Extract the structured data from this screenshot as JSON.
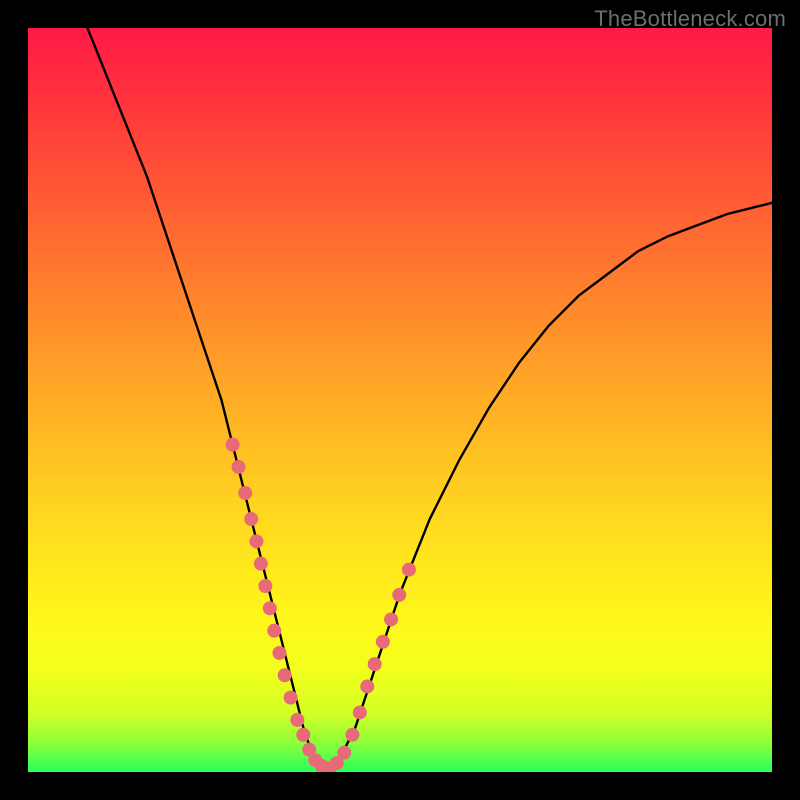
{
  "watermark": "TheBottleneck.com",
  "chart_data": {
    "type": "line",
    "title": "",
    "xlabel": "",
    "ylabel": "",
    "xlim": [
      0,
      100
    ],
    "ylim": [
      0,
      100
    ],
    "series": [
      {
        "name": "bottleneck-curve",
        "x": [
          8,
          12,
          16,
          20,
          22,
          24,
          26,
          28,
          30,
          32,
          33,
          34,
          35,
          36,
          37,
          38,
          39,
          40,
          41,
          42,
          44,
          46,
          48,
          50,
          54,
          58,
          62,
          66,
          70,
          74,
          78,
          82,
          86,
          90,
          94,
          98,
          100
        ],
        "y": [
          100,
          90,
          80,
          68,
          62,
          56,
          50,
          42,
          34,
          26,
          22,
          18,
          14,
          10,
          6,
          3,
          1,
          0,
          0.5,
          2,
          6,
          12,
          18,
          24,
          34,
          42,
          49,
          55,
          60,
          64,
          67,
          70,
          72,
          73.5,
          75,
          76,
          76.5
        ]
      }
    ],
    "highlight_points": {
      "name": "marked-region",
      "x": [
        27.5,
        28.3,
        29.2,
        30.0,
        30.7,
        31.3,
        31.9,
        32.5,
        33.1,
        33.8,
        34.5,
        35.3,
        36.2,
        37.0,
        37.8,
        38.6,
        39.5,
        40.5,
        41.5,
        42.5,
        43.6,
        44.6,
        45.6,
        46.6,
        47.7,
        48.8,
        49.9,
        51.2
      ],
      "y": [
        44,
        41,
        37.5,
        34,
        31,
        28,
        25,
        22,
        19,
        16,
        13,
        10,
        7,
        5,
        3,
        1.6,
        0.8,
        0.5,
        1.2,
        2.6,
        5,
        8,
        11.5,
        14.5,
        17.5,
        20.5,
        23.8,
        27.2
      ]
    },
    "colors": {
      "curve": "#000000",
      "points": "#e86a78"
    }
  }
}
